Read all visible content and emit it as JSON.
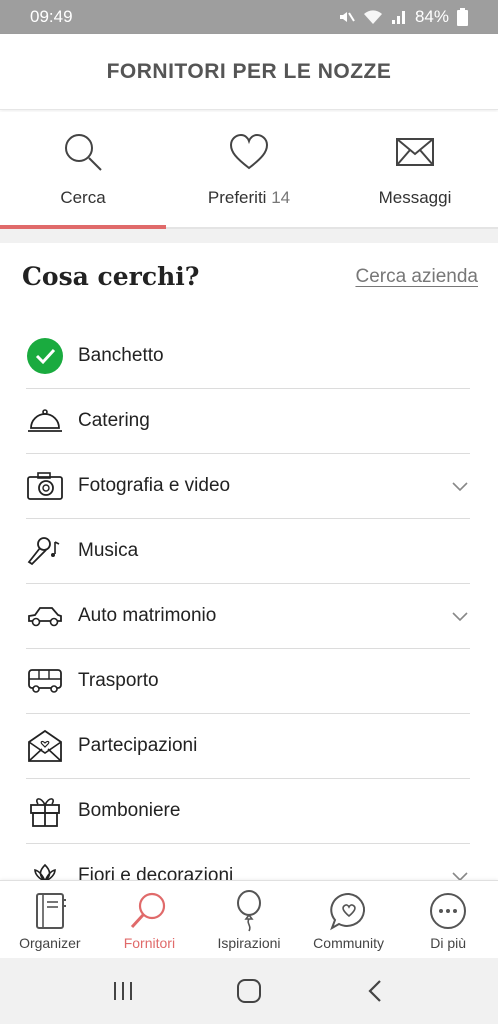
{
  "status_bar": {
    "time": "09:49",
    "battery": "84%"
  },
  "header": {
    "title": "FORNITORI PER LE NOZZE"
  },
  "tabs": [
    {
      "label": "Cerca",
      "count": "",
      "icon": "search-icon",
      "active": true
    },
    {
      "label": "Preferiti",
      "count": "14",
      "icon": "heart-icon",
      "active": false
    },
    {
      "label": "Messaggi",
      "count": "",
      "icon": "envelope-icon",
      "active": false
    }
  ],
  "search": {
    "title": "Cosa cerchi?",
    "company_link": "Cerca azienda"
  },
  "categories": [
    {
      "label": "Banchetto",
      "icon": "check-circle-icon",
      "selected": true,
      "has_dropdown": false
    },
    {
      "label": "Catering",
      "icon": "cloche-icon",
      "selected": false,
      "has_dropdown": false
    },
    {
      "label": "Fotografia e video",
      "icon": "camera-icon",
      "selected": false,
      "has_dropdown": true
    },
    {
      "label": "Musica",
      "icon": "microphone-icon",
      "selected": false,
      "has_dropdown": false
    },
    {
      "label": "Auto matrimonio",
      "icon": "car-icon",
      "selected": false,
      "has_dropdown": true
    },
    {
      "label": "Trasporto",
      "icon": "bus-icon",
      "selected": false,
      "has_dropdown": false
    },
    {
      "label": "Partecipazioni",
      "icon": "invitation-icon",
      "selected": false,
      "has_dropdown": false
    },
    {
      "label": "Bomboniere",
      "icon": "gift-icon",
      "selected": false,
      "has_dropdown": false
    },
    {
      "label": "Fiori e decorazioni",
      "icon": "flower-icon",
      "selected": false,
      "has_dropdown": true
    }
  ],
  "bottom_nav": [
    {
      "label": "Organizer",
      "icon": "notebook-icon",
      "active": false
    },
    {
      "label": "Fornitori",
      "icon": "magnifier-icon",
      "active": true
    },
    {
      "label": "Ispirazioni",
      "icon": "balloon-icon",
      "active": false
    },
    {
      "label": "Community",
      "icon": "chat-heart-icon",
      "active": false
    },
    {
      "label": "Di più",
      "icon": "more-icon",
      "active": false
    }
  ],
  "colors": {
    "accent": "#e06a6a",
    "check_green": "#1aab3f",
    "status_bar": "#9e9e9e"
  }
}
